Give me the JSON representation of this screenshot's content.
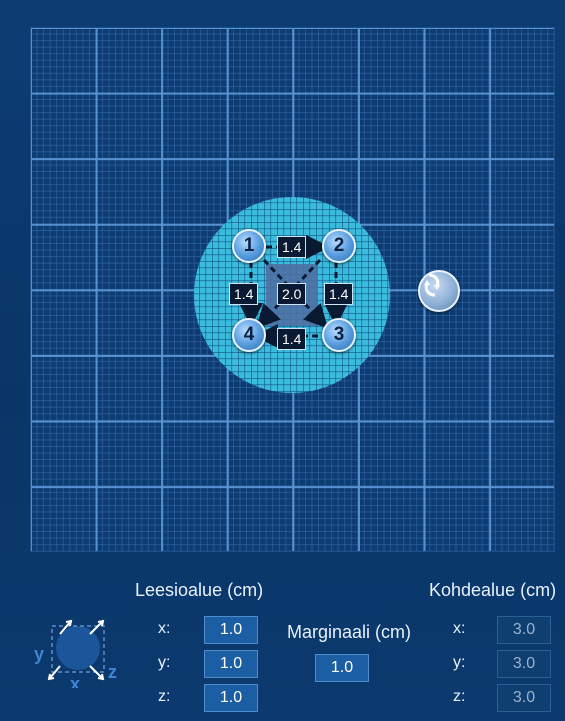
{
  "canvas": {
    "segments": {
      "top": "1.4",
      "left": "1.4",
      "center": "2.0",
      "right": "1.4",
      "bottom": "1.4"
    },
    "points": [
      "1",
      "2",
      "3",
      "4"
    ]
  },
  "lesion": {
    "heading": "Leesioalue (cm)",
    "x_label": "x:",
    "x_value": "1.0",
    "y_label": "y:",
    "y_value": "1.0",
    "z_label": "z:",
    "z_value": "1.0"
  },
  "margin": {
    "heading": "Marginaali (cm)",
    "value": "1.0"
  },
  "target": {
    "heading": "Kohdealue (cm)",
    "x_label": "x:",
    "x_value": "3.0",
    "y_label": "y:",
    "y_value": "3.0",
    "z_label": "z:",
    "z_value": "3.0"
  },
  "cube_axes": {
    "x": "x",
    "y": "y",
    "z": "z"
  },
  "icons": {
    "rotate": "rotate-arrows-icon",
    "cube": "3d-cube-axes-icon"
  },
  "colors": {
    "background": "#0d3d73",
    "target_area": "#3bb9d9",
    "lesion_area": "#4d6fa3"
  }
}
